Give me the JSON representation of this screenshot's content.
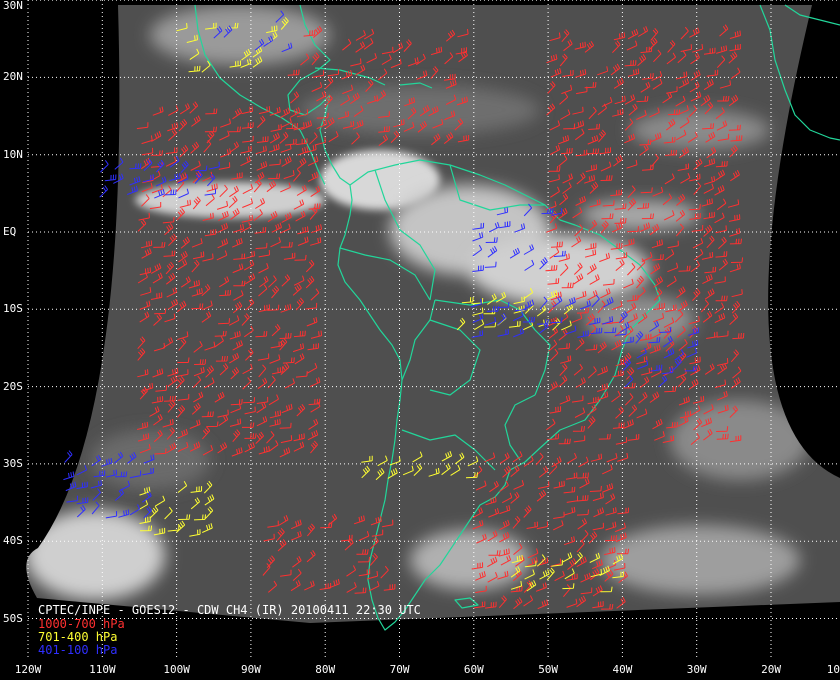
{
  "caption": {
    "title": "CPTEC/INPE - GOES12 - CDW CH4 (IR) 20100411 22:30 UTC",
    "legend": [
      {
        "label": "1000-700 hPa",
        "color": "#ff3030"
      },
      {
        "label": "701-400 hPa",
        "color": "#ffff33"
      },
      {
        "label": "401-100 hPa",
        "color": "#2f2fff"
      }
    ]
  },
  "colors": {
    "background": "#000000",
    "imagery": "#4f4f4f",
    "cloud": "#d8d8d8",
    "coastline": "#22d69a",
    "grid": "#ffffff"
  },
  "latitude_labels": [
    "30N",
    "20N",
    "10N",
    "EQ",
    "10S",
    "20S",
    "30S",
    "40S",
    "50S"
  ],
  "longitude_labels": [
    "120W",
    "110W",
    "100W",
    "90W",
    "80W",
    "70W",
    "60W",
    "50W",
    "40W",
    "30W",
    "20W",
    "10"
  ],
  "map_extent": {
    "lon_min": -120,
    "lon_max": -10,
    "lat_min": -55,
    "lat_max": 30
  },
  "wind_regions": [
    {
      "layer": "low",
      "lon": [
        -105,
        -82
      ],
      "lat": [
        -30,
        15
      ],
      "density": 0.85
    },
    {
      "layer": "low",
      "lon": [
        -50,
        -25
      ],
      "lat": [
        -28,
        25
      ],
      "density": 0.8
    },
    {
      "layer": "low",
      "lon": [
        -60,
        -40
      ],
      "lat": [
        -50,
        -30
      ],
      "density": 0.8
    },
    {
      "layer": "low",
      "lon": [
        -85,
        -62
      ],
      "lat": [
        10,
        25
      ],
      "density": 0.6
    },
    {
      "layer": "low",
      "lon": [
        -88,
        -72
      ],
      "lat": [
        -48,
        -38
      ],
      "density": 0.7
    },
    {
      "layer": "mid",
      "lon": [
        -105,
        -95
      ],
      "lat": [
        -40,
        -34
      ],
      "density": 0.8
    },
    {
      "layer": "mid",
      "lon": [
        -75,
        -60
      ],
      "lat": [
        -33,
        -30
      ],
      "density": 0.8
    },
    {
      "layer": "mid",
      "lon": [
        -62,
        -48
      ],
      "lat": [
        -13,
        -9
      ],
      "density": 0.8
    },
    {
      "layer": "mid",
      "lon": [
        -55,
        -40
      ],
      "lat": [
        -47,
        -43
      ],
      "density": 0.8
    },
    {
      "layer": "mid",
      "lon": [
        -100,
        -85
      ],
      "lat": [
        20,
        26
      ],
      "density": 0.4
    },
    {
      "layer": "high",
      "lon": [
        -110,
        -95
      ],
      "lat": [
        3,
        8
      ],
      "density": 0.8
    },
    {
      "layer": "high",
      "lon": [
        -115,
        -103
      ],
      "lat": [
        -38,
        -30
      ],
      "density": 0.8
    },
    {
      "layer": "high",
      "lon": [
        -60,
        -40
      ],
      "lat": [
        -15,
        -10
      ],
      "density": 0.8
    },
    {
      "layer": "high",
      "lon": [
        -40,
        -30
      ],
      "lat": [
        -20,
        -13
      ],
      "density": 0.7
    },
    {
      "layer": "high",
      "lon": [
        -95,
        -85
      ],
      "lat": [
        22,
        27
      ],
      "density": 0.5
    },
    {
      "layer": "high",
      "lon": [
        -60,
        -48
      ],
      "lat": [
        -5,
        2
      ],
      "density": 0.6
    }
  ]
}
